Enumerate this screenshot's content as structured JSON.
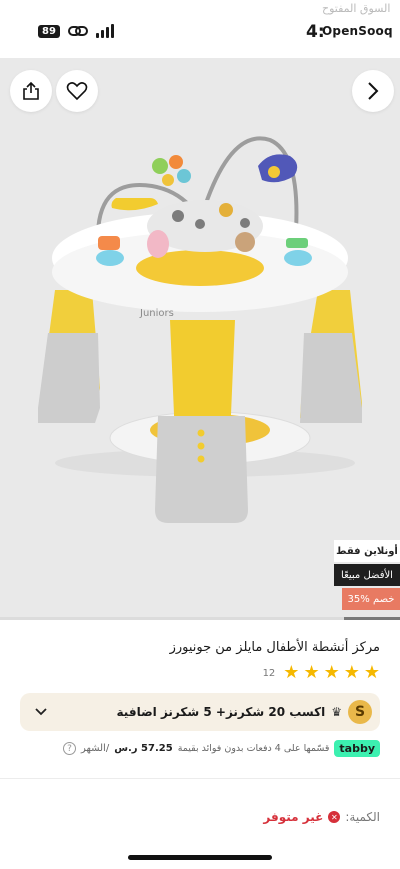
{
  "status_bar": {
    "time": "4:",
    "battery": "89",
    "brand": "OpenSooq",
    "brand_ar": "السوق المفتوح"
  },
  "product_image": {
    "brand_mark": "Juniors",
    "tags": {
      "online": "أونلاين فقط",
      "best": "الأفضل مبيعًا",
      "discount": "35% خصم"
    },
    "gallery_progress": 0.14
  },
  "product": {
    "title": "مركز أنشطة الأطفال مايلز من جونيورز",
    "rating": 5,
    "rating_count": "12"
  },
  "rewards": {
    "badge": "S",
    "text": "اكسب 20 شكرنز+ 5 شكرنز اضافية"
  },
  "tabby": {
    "logo": "tabby",
    "text": "قسّمها على 4 دفعات بدون فوائد بقيمة",
    "amount": "57.25 ر.س",
    "per": "/الشهر"
  },
  "quantity": {
    "label": "الكمية:",
    "status": "غير متوفر"
  },
  "colors": {
    "accent_red": "#d6303a",
    "tabby_green": "#3cf0b0",
    "star": "#f5b800",
    "discount": "#e87a62"
  }
}
